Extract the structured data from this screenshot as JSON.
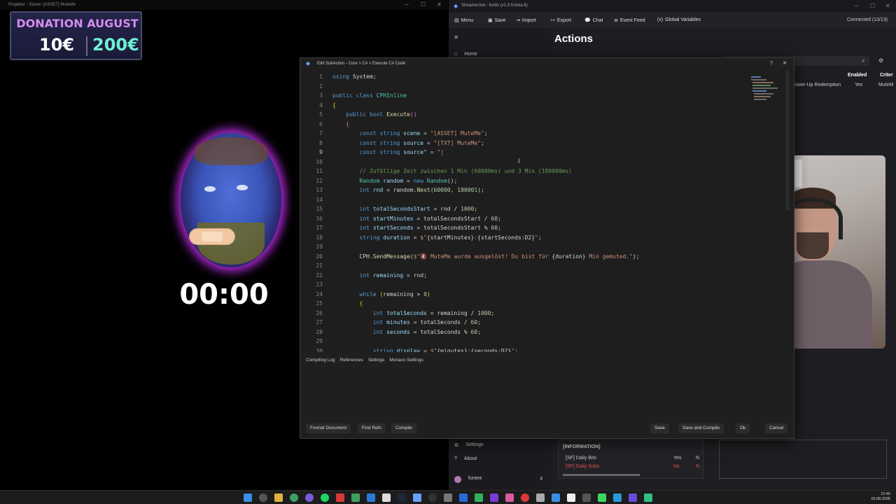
{
  "projector": {
    "title": "Projektor - Szene: [ASSET] MuteMe",
    "donation_title": "DONATION AUGUST",
    "amount_current": "10€",
    "amount_goal": "200€",
    "timer": "00:00"
  },
  "streamerbot": {
    "title": "Streamer.bot - funtis (v1.0.5-beta.6)",
    "toolbar": {
      "menu": "Menu",
      "save": "Save",
      "import": "Import",
      "export": "Export",
      "chat": "Chat",
      "event_feed": "Event Feed",
      "global_variables": "Global Variables"
    },
    "connection": "Connected (13/13)",
    "page_title": "Actions",
    "sidebar": {
      "home": "Home",
      "settings": "Settings",
      "about": "About",
      "user": "funtee"
    },
    "table": {
      "col_enabled": "Enabled",
      "col_criteria": "Criter",
      "row_name": "ower-Up Redemption",
      "row_enabled": "Yes",
      "row_crit": "MuteM"
    },
    "info_panel": {
      "title": "[INFORMATION]",
      "rows": [
        {
          "name": "[SF] Daily Bits",
          "enabled": "Yes",
          "flag": "N"
        },
        {
          "name": "[SF] Daily Subs",
          "enabled": "No",
          "flag": "N"
        }
      ]
    }
  },
  "dialog": {
    "title": "Edit SubAction - Core > C# > Execute C# Code",
    "help": "?",
    "close": "×",
    "code_lines": [
      {
        "n": "1",
        "html": "<span class=\"kw\">using</span> System;"
      },
      {
        "n": "2",
        "html": ""
      },
      {
        "n": "3",
        "html": "<span class=\"kw\">public class</span> <span class=\"ty\">CPHInline</span>"
      },
      {
        "n": "4",
        "html": "<span class=\"br\">{</span>"
      },
      {
        "n": "5",
        "html": "    <span class=\"kw\">public bool</span> <span class=\"fn\">Execute</span><span class=\"br2\">()</span>"
      },
      {
        "n": "6",
        "html": "    <span class=\"br2\">{</span>"
      },
      {
        "n": "7",
        "html": "        <span class=\"kw\">const string</span> <span class=\"vr\">scene</span> = <span class=\"st\">\"[ASSET] MuteMe\"</span>;"
      },
      {
        "n": "8",
        "html": "        <span class=\"kw\">const string</span> <span class=\"vr\">source</span> = <span class=\"st\">\"[TXT] MuteMe\"</span>;"
      },
      {
        "n": "9",
        "html": "        <span class=\"kw\">const string</span> <span class=\"vr\">source</span>\" = <span class=\"st\">\"|</span>"
      },
      {
        "n": "10",
        "html": ""
      },
      {
        "n": "11",
        "html": "        <span class=\"cm\">// Zufällige Zeit zwischen 1 Min (60000ms) und 3 Min (180000ms)</span>"
      },
      {
        "n": "12",
        "html": "        <span class=\"ty\">Random</span> <span class=\"vr\">random</span> = <span class=\"kw\">new</span> <span class=\"ty\">Random</span>();"
      },
      {
        "n": "13",
        "html": "        <span class=\"kw\">int</span> <span class=\"vr\">rnd</span> = random.<span class=\"fn\">Next</span>(<span class=\"nm\">60000</span>, <span class=\"nm\">180001</span>);"
      },
      {
        "n": "14",
        "html": ""
      },
      {
        "n": "15",
        "html": "        <span class=\"kw\">int</span> <span class=\"vr\">totalSecondsStart</span> = rnd / <span class=\"nm\">1000</span>;"
      },
      {
        "n": "16",
        "html": "        <span class=\"kw\">int</span> <span class=\"vr\">startMinutes</span> = totalSecondsStart / <span class=\"nm\">60</span>;"
      },
      {
        "n": "17",
        "html": "        <span class=\"kw\">int</span> <span class=\"vr\">startSeconds</span> = totalSecondsStart % <span class=\"nm\">60</span>;"
      },
      {
        "n": "18",
        "html": "        <span class=\"kw\">string</span> <span class=\"vr\">duration</span> = <span class=\"st\">$\"</span>{startMinutes}<span class=\"st\">:</span>{startSeconds:D2}<span class=\"st\">\"</span>;"
      },
      {
        "n": "19",
        "html": ""
      },
      {
        "n": "20",
        "html": "        CPH.<span class=\"fn\">SendMessage</span>(<span class=\"st\">$\"🔇 MuteMe wurde ausgelöst! Du bist für </span>{duration}<span class=\"st\"> Min gemuted.\"</span>);"
      },
      {
        "n": "21",
        "html": ""
      },
      {
        "n": "22",
        "html": "        <span class=\"kw\">int</span> <span class=\"vr\">remaining</span> = rnd;"
      },
      {
        "n": "23",
        "html": ""
      },
      {
        "n": "24",
        "html": "        <span class=\"kw\">while</span> <span class=\"br\">(</span>remaining &gt; <span class=\"nm\">0</span><span class=\"br\">)</span>"
      },
      {
        "n": "25",
        "html": "        <span class=\"br\">{</span>"
      },
      {
        "n": "26",
        "html": "            <span class=\"kw\">int</span> <span class=\"vr\">totalSeconds</span> = remaining / <span class=\"nm\">1000</span>;"
      },
      {
        "n": "27",
        "html": "            <span class=\"kw\">int</span> <span class=\"vr\">minutes</span> = totalSeconds / <span class=\"nm\">60</span>;"
      },
      {
        "n": "28",
        "html": "            <span class=\"kw\">int</span> <span class=\"vr\">seconds</span> = totalSeconds % <span class=\"nm\">60</span>;"
      },
      {
        "n": "29",
        "html": ""
      },
      {
        "n": "30",
        "html": "            <span class=\"kw\">string</span> <span class=\"vr\">display</span> = <span class=\"st\">$\"</span>{minutes}<span class=\"st\">:</span>{seconds:D2}<span class=\"st\">\"</span>;"
      }
    ],
    "tabs": [
      "Compiling Log",
      "References",
      "Settings",
      "Monaco Settings"
    ],
    "buttons": {
      "format": "Format Document",
      "find_refs": "Find Refs",
      "compile": "Compile",
      "save": "Save",
      "save_compile": "Save and Compile",
      "ok": "Ok",
      "cancel": "Cancel"
    }
  },
  "taskbar": {
    "time": "12:45",
    "date": "03.08.2026"
  }
}
